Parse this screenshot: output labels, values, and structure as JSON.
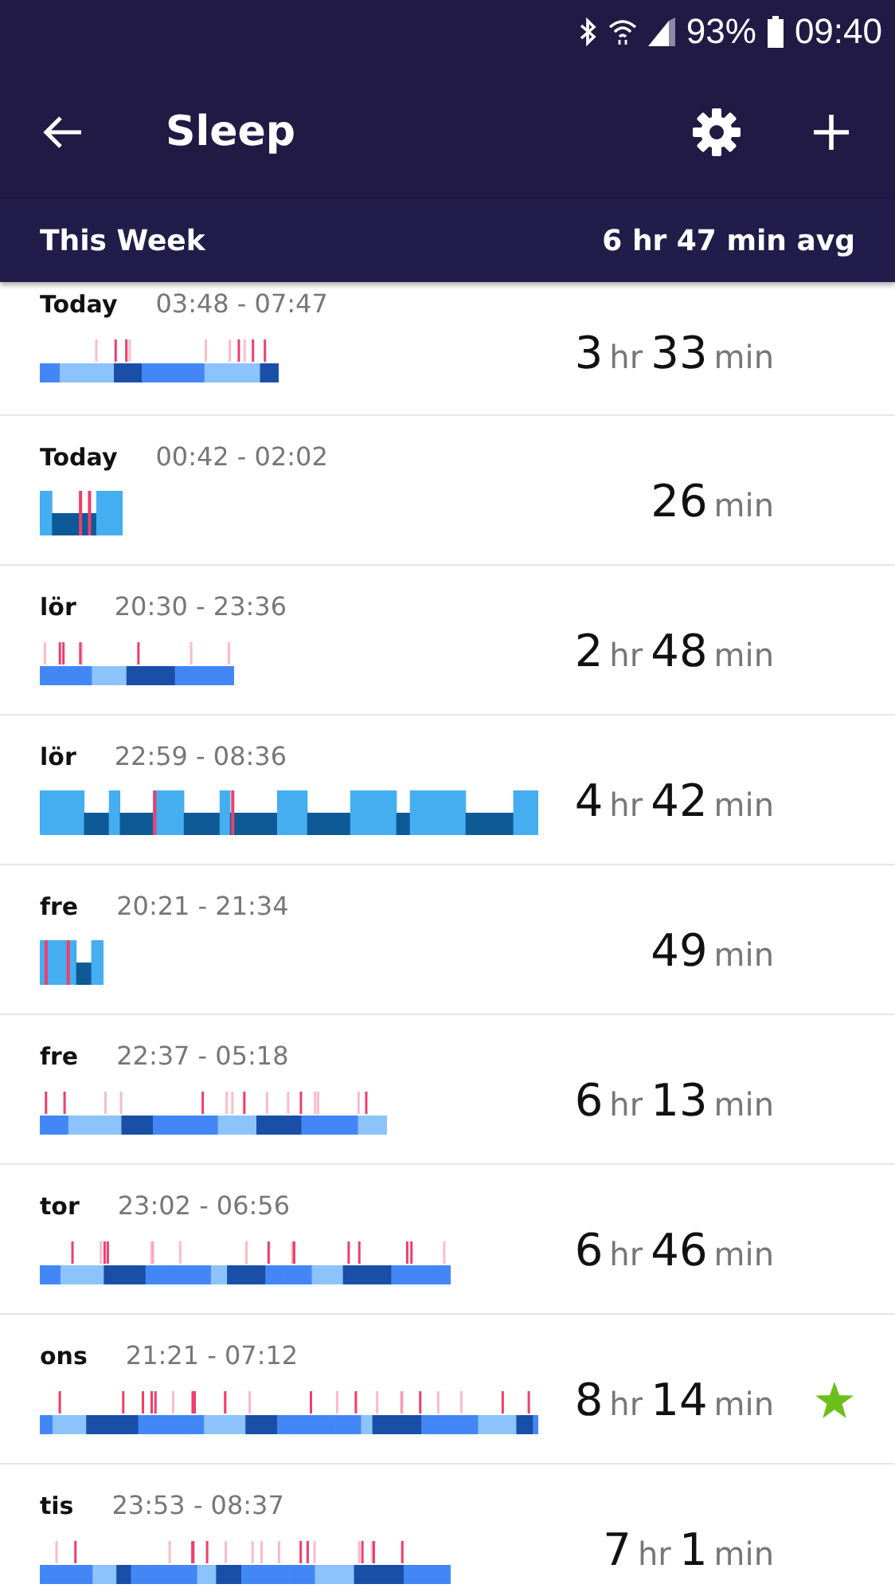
{
  "status_bar": {
    "battery": "93%",
    "time": "09:40"
  },
  "header": {
    "title": "Sleep"
  },
  "week_bar": {
    "label": "This Week",
    "average": "6 hr 47 min avg"
  },
  "rows": [
    {
      "day": "Today",
      "range": "03:48 - 07:47",
      "kind": "stages",
      "duration": [
        {
          "value": "3",
          "unit": "hr"
        },
        {
          "value": "33",
          "unit": "min"
        }
      ],
      "starred": false
    },
    {
      "day": "Today",
      "range": "00:42 - 02:02",
      "kind": "classic",
      "duration": [
        {
          "value": "26",
          "unit": "min"
        }
      ],
      "starred": false
    },
    {
      "day": "lör",
      "range": "20:30 - 23:36",
      "kind": "stages",
      "duration": [
        {
          "value": "2",
          "unit": "hr"
        },
        {
          "value": "48",
          "unit": "min"
        }
      ],
      "starred": false
    },
    {
      "day": "lör",
      "range": "22:59 - 08:36",
      "kind": "classic",
      "duration": [
        {
          "value": "4",
          "unit": "hr"
        },
        {
          "value": "42",
          "unit": "min"
        }
      ],
      "starred": false
    },
    {
      "day": "fre",
      "range": "20:21 - 21:34",
      "kind": "classic",
      "duration": [
        {
          "value": "49",
          "unit": "min"
        }
      ],
      "starred": false
    },
    {
      "day": "fre",
      "range": "22:37 - 05:18",
      "kind": "stages",
      "duration": [
        {
          "value": "6",
          "unit": "hr"
        },
        {
          "value": "13",
          "unit": "min"
        }
      ],
      "starred": false
    },
    {
      "day": "tor",
      "range": "23:02 - 06:56",
      "kind": "stages",
      "duration": [
        {
          "value": "6",
          "unit": "hr"
        },
        {
          "value": "46",
          "unit": "min"
        }
      ],
      "starred": false
    },
    {
      "day": "ons",
      "range": "21:21 - 07:12",
      "kind": "stages",
      "duration": [
        {
          "value": "8",
          "unit": "hr"
        },
        {
          "value": "14",
          "unit": "min"
        }
      ],
      "starred": true
    },
    {
      "day": "tis",
      "range": "23:53 - 08:37",
      "kind": "stages",
      "duration": [
        {
          "value": "7",
          "unit": "hr"
        },
        {
          "value": "1",
          "unit": "min"
        }
      ],
      "starred": false
    }
  ]
}
